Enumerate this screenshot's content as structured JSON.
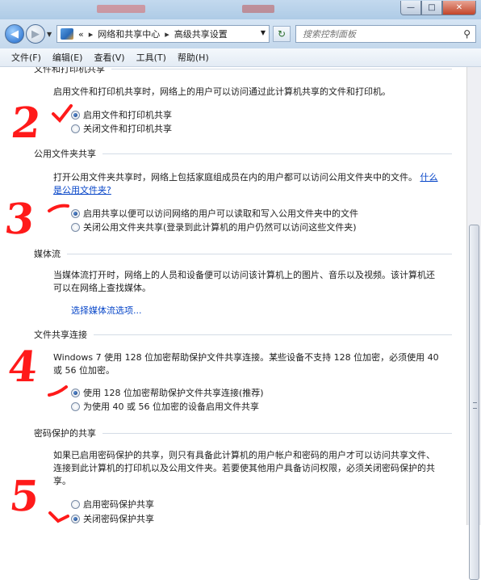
{
  "window": {
    "minimize_glyph": "—",
    "maximize_glyph": "□",
    "close_glyph": "✕"
  },
  "address": {
    "overflow": "«",
    "crumb1": "网络和共享中心",
    "sep": "▸",
    "crumb2": "高级共享设置",
    "search_placeholder": "搜索控制面板"
  },
  "menu": [
    "文件(F)",
    "编辑(E)",
    "查看(V)",
    "工具(T)",
    "帮助(H)"
  ],
  "sections": {
    "file_printer": {
      "title": "文件和打印机共享",
      "desc": "启用文件和打印机共享时，网络上的用户可以访问通过此计算机共享的文件和打印机。",
      "options": [
        "启用文件和打印机共享",
        "关闭文件和打印机共享"
      ],
      "selected": 0
    },
    "public_folder": {
      "title": "公用文件夹共享",
      "desc_line1": "打开公用文件夹共享时，网络上包括家庭组成员在内的用户都可以访问公用文件夹中的文件。",
      "link_part1": "什么",
      "link_part2": "是公用文件夹?",
      "options": [
        "启用共享以便可以访问网络的用户可以读取和写入公用文件夹中的文件",
        "关闭公用文件夹共享(登录到此计算机的用户仍然可以访问这些文件夹)"
      ],
      "selected": 0
    },
    "media": {
      "title": "媒体流",
      "desc_line1": "当媒体流打开时，网络上的人员和设备便可以访问该计算机上的图片、音乐以及视频。该计算机还",
      "desc_line2": "可以在网络上查找媒体。",
      "link": "选择媒体流选项..."
    },
    "connection": {
      "title": "文件共享连接",
      "desc_line1": "Windows 7 使用 128 位加密帮助保护文件共享连接。某些设备不支持 128 位加密，必须使用 40",
      "desc_line2": "或 56 位加密。",
      "options": [
        "使用 128 位加密帮助保护文件共享连接(推荐)",
        "为使用 40 或 56 位加密的设备启用文件共享"
      ],
      "selected": 0
    },
    "password": {
      "title": "密码保护的共享",
      "desc_line1": "如果已启用密码保护的共享，则只有具备此计算机的用户帐户和密码的用户才可以访问共享文件、",
      "desc_line2": "连接到此计算机的打印机以及公用文件夹。若要使其他用户具备访问权限，必须关闭密码保护的共",
      "desc_line3": "享。",
      "options": [
        "启用密码保护共享",
        "关闭密码保护共享"
      ],
      "selected": 1
    }
  },
  "annotations": [
    "2",
    "3",
    "4",
    "5"
  ],
  "colors": {
    "annotation": "#ff1a1a",
    "link": "#0645c8"
  }
}
